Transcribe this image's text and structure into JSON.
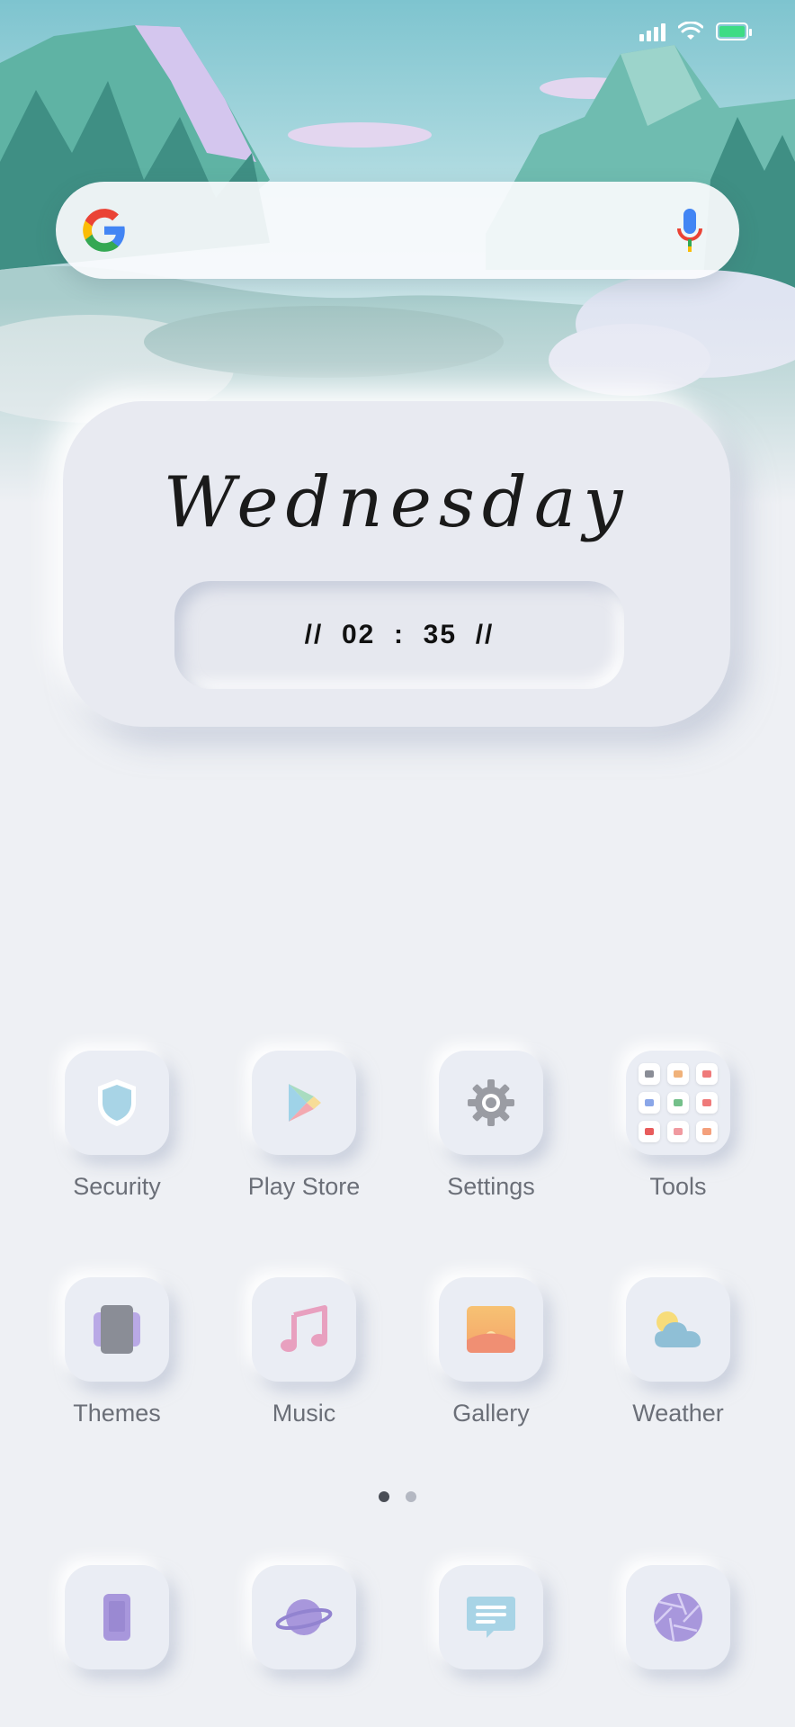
{
  "status_bar": {
    "signal_icon": "signal-bars-icon",
    "wifi_icon": "wifi-icon",
    "battery_icon": "battery-icon",
    "battery_color": "#3ddc84"
  },
  "search": {
    "logo_icon": "google-g-icon",
    "mic_icon": "microphone-icon"
  },
  "widget": {
    "day": "Wednesday",
    "time": "//  02  :  35  //"
  },
  "apps": [
    {
      "label": "Security",
      "icon": "shield-icon"
    },
    {
      "label": "Play Store",
      "icon": "play-store-icon"
    },
    {
      "label": "Settings",
      "icon": "gear-icon"
    },
    {
      "label": "Tools",
      "icon": "tools-folder-icon"
    },
    {
      "label": "Themes",
      "icon": "themes-icon"
    },
    {
      "label": "Music",
      "icon": "music-note-icon"
    },
    {
      "label": "Gallery",
      "icon": "gallery-icon"
    },
    {
      "label": "Weather",
      "icon": "weather-icon"
    }
  ],
  "page_indicator": {
    "pages": 2,
    "current": 1
  },
  "dock": [
    {
      "icon": "phone-icon"
    },
    {
      "icon": "browser-planet-icon"
    },
    {
      "icon": "messages-icon"
    },
    {
      "icon": "camera-aperture-icon"
    }
  ],
  "colors": {
    "background": "#eef0f4",
    "accent_purple": "#a897dc",
    "accent_blue": "#a8d4e6"
  }
}
